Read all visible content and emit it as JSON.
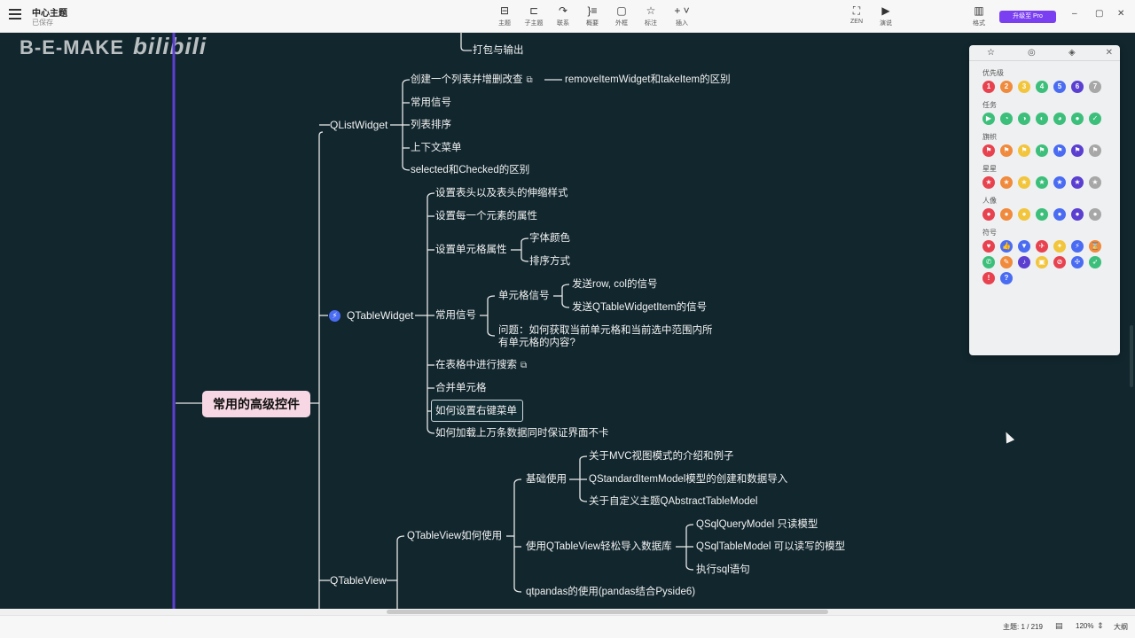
{
  "app": {
    "title": "中心主题",
    "status": "已保存"
  },
  "toolbar": {
    "items": [
      {
        "label": "主题",
        "icon": "insert-topic-icon",
        "glyph": "⊟"
      },
      {
        "label": "子主题",
        "icon": "subtopic-icon",
        "glyph": "⊏"
      },
      {
        "label": "联系",
        "icon": "relationship-icon",
        "glyph": "↷"
      },
      {
        "label": "概要",
        "icon": "summary-icon",
        "glyph": "}≡"
      },
      {
        "label": "外框",
        "icon": "boundary-icon",
        "glyph": "▢"
      },
      {
        "label": "标注",
        "icon": "callout-icon",
        "glyph": "☆"
      },
      {
        "label": "插入",
        "icon": "insert-plus-icon",
        "glyph": "+ ˅"
      }
    ],
    "zen_label": "ZEN",
    "present_label": "演说",
    "format_label": "格式",
    "pro_label": "升级至 Pro"
  },
  "watermark": {
    "text": "B-E-MAKE",
    "bili": "bilibili"
  },
  "mindmap": {
    "root": "常用的高级控件",
    "top_partial": "打包与输出",
    "qlistwidget": {
      "label": "QListWidget",
      "children": [
        "创建一个列表并增删改查",
        "常用信号",
        "列表排序",
        "上下文菜单",
        "selected和Checked的区别"
      ],
      "note": "removeItemWidget和takeItem的区别"
    },
    "qtablewidget": {
      "label": "QTableWidget",
      "children": {
        "header": "设置表头以及表头的伸缩样式",
        "item_attr": "设置每一个元素的属性",
        "cell_attr": "设置单元格属性",
        "font_color": "字体颜色",
        "sort_mode": "排序方式",
        "signals": "常用信号",
        "cell_signal": "单元格信号",
        "send_rowcol": "发送row, col的信号",
        "send_item": "发送QTableWidgetItem的信号",
        "question_l1": "问题：如何获取当前单元格和当前选中范围内所",
        "question_l2": "有单元格的内容?",
        "search": "在表格中进行搜索",
        "merge": "合并单元格",
        "context_menu": "如何设置右键菜单",
        "big_data": "如何加载上万条数据同时保证界面不卡"
      }
    },
    "qtableview": {
      "label": "QTableView",
      "howto": "QTableView如何使用",
      "basic": "基础使用",
      "mvc": "关于MVC视图模式的介绍和例子",
      "standard_model": "QStandardItemModel模型的创建和数据导入",
      "abstract_model": "关于自定义主题QAbstractTableModel",
      "db_import": "使用QTableView轻松导入数据库",
      "query_model": "QSqlQueryModel 只读模型",
      "table_model": "QSqlTableModel 可以读写的模型",
      "exec_sql": "执行sql语句",
      "qtpandas": "qtpandas的使用(pandas结合Pyside6)"
    }
  },
  "marker_panel": {
    "sections": [
      {
        "title": "优先级",
        "glyphs": [
          "1",
          "2",
          "3",
          "4",
          "5",
          "6",
          "7"
        ],
        "colors": [
          "#e8424f",
          "#f08a3c",
          "#f2c53d",
          "#3cbf7a",
          "#4a6cf2",
          "#5b3fd1",
          "#a7a7a7"
        ]
      },
      {
        "title": "任务",
        "glyphs": [
          "▶",
          "◔",
          "◑",
          "◐",
          "◕",
          "●",
          "✓"
        ],
        "colors": [
          "#3cbf7a",
          "#3cbf7a",
          "#3cbf7a",
          "#3cbf7a",
          "#3cbf7a",
          "#3cbf7a",
          "#3cbf7a"
        ]
      },
      {
        "title": "旗帜",
        "glyphs": [
          "⚑",
          "⚑",
          "⚑",
          "⚑",
          "⚑",
          "⚑",
          "⚑"
        ],
        "colors": [
          "#e8424f",
          "#f08a3c",
          "#f2c53d",
          "#3cbf7a",
          "#4a6cf2",
          "#5b3fd1",
          "#a7a7a7"
        ]
      },
      {
        "title": "星星",
        "glyphs": [
          "★",
          "★",
          "★",
          "★",
          "★",
          "★",
          "★"
        ],
        "colors": [
          "#e8424f",
          "#f08a3c",
          "#f2c53d",
          "#3cbf7a",
          "#4a6cf2",
          "#5b3fd1",
          "#a7a7a7"
        ]
      },
      {
        "title": "人像",
        "glyphs": [
          "●",
          "●",
          "●",
          "●",
          "●",
          "●",
          "●"
        ],
        "colors": [
          "#e8424f",
          "#f08a3c",
          "#f2c53d",
          "#3cbf7a",
          "#4a6cf2",
          "#5b3fd1",
          "#a7a7a7"
        ]
      },
      {
        "title": "符号",
        "glyphs": [
          "♥",
          "👍",
          "▼",
          "✈",
          "✦",
          "⚡",
          "⌛"
        ],
        "colors": [
          "#e8424f",
          "#4a6cf2",
          "#4a6cf2",
          "#e8424f",
          "#f2c53d",
          "#4a6cf2",
          "#f08a3c"
        ]
      },
      {
        "title": "",
        "glyphs": [
          "✆",
          "✎",
          "♪",
          "▣",
          "⊘",
          "✢",
          "➶"
        ],
        "colors": [
          "#3cbf7a",
          "#f08a3c",
          "#5b3fd1",
          "#f2c53d",
          "#e8424f",
          "#4a6cf2",
          "#3cbf7a"
        ]
      },
      {
        "title": "",
        "glyphs": [
          "!",
          "?"
        ],
        "colors": [
          "#e8424f",
          "#4a6cf2"
        ]
      }
    ]
  },
  "statusbar": {
    "topics_label": "主题:",
    "topics_value": "1 / 219",
    "zoom": "120%",
    "view_label": "大纲"
  }
}
